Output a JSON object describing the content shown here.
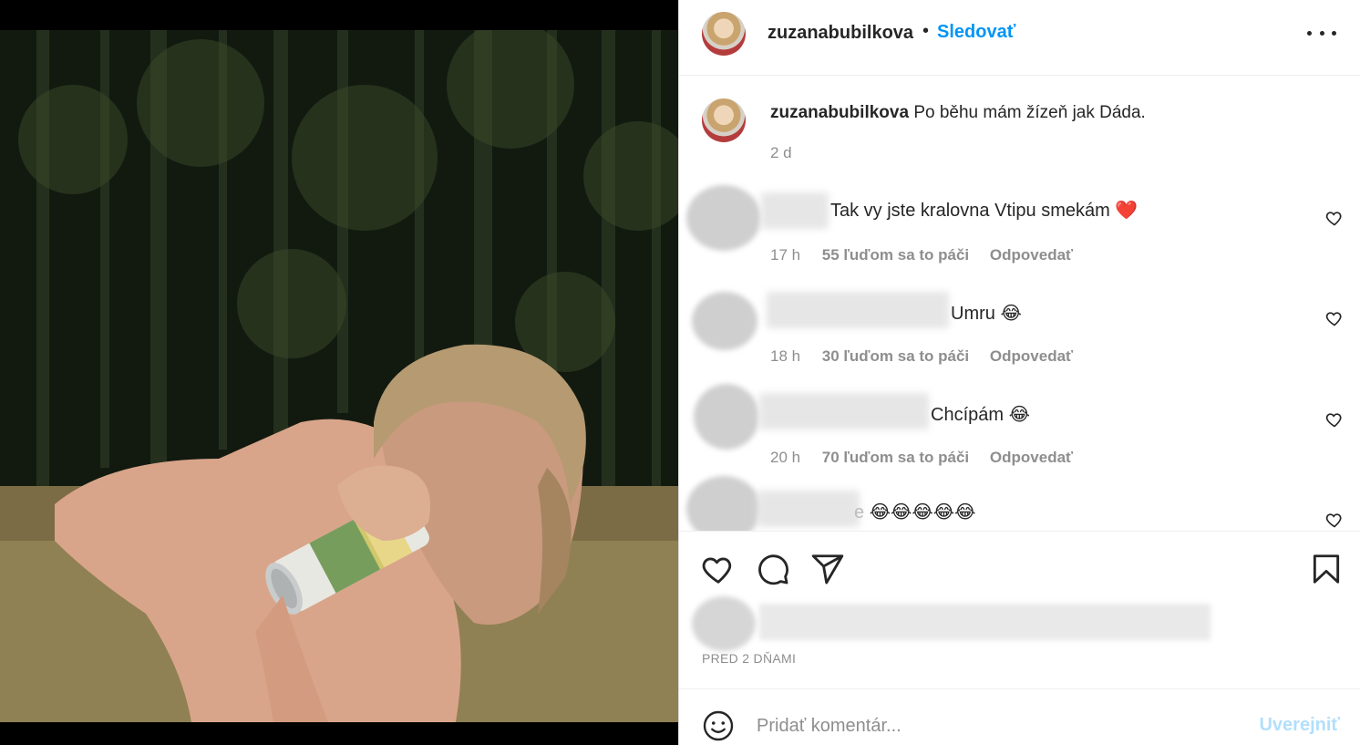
{
  "post": {
    "image_alt": "Selfie photo of a woman drinking from a can in a forest clearing"
  },
  "header": {
    "username": "zuzanabubilkova",
    "separator": "•",
    "follow_label": "Sledovať",
    "more_icon": "more-options-icon"
  },
  "caption": {
    "username": "zuzanabubilkova",
    "text": "Po běhu mám žízeň jak Dáda.",
    "time": "2 d"
  },
  "comments": [
    {
      "text": "Tak vy jste kralovna Vtipu smekám",
      "emoji": "❤️",
      "time": "17 h",
      "likes": "55 ľuďom sa to páči",
      "reply": "Odpovedať"
    },
    {
      "text": "Umru",
      "emoji": "😂",
      "time": "18 h",
      "likes": "30 ľuďom sa to páči",
      "reply": "Odpovedať"
    },
    {
      "text": "Chcípám",
      "emoji": "😂",
      "time": "20 h",
      "likes": "70 ľuďom sa to páči",
      "reply": "Odpovedať"
    },
    {
      "text": "e",
      "emoji": "😂😂😂😂😂",
      "time": "",
      "likes": "",
      "reply": ""
    }
  ],
  "actions": {
    "like_icon": "heart-icon",
    "comment_icon": "comment-icon",
    "share_icon": "share-icon",
    "save_icon": "bookmark-icon"
  },
  "post_date": "PRED 2 DŇAMI",
  "add_comment": {
    "placeholder": "Pridať komentár...",
    "post_label": "Uverejniť",
    "emoji_icon": "smile-icon"
  },
  "colors": {
    "link_blue": "#0095f6",
    "post_disabled": "#b2dffc",
    "text": "#262626",
    "muted": "#8e8e8e",
    "heart_red": "#e0245e"
  }
}
